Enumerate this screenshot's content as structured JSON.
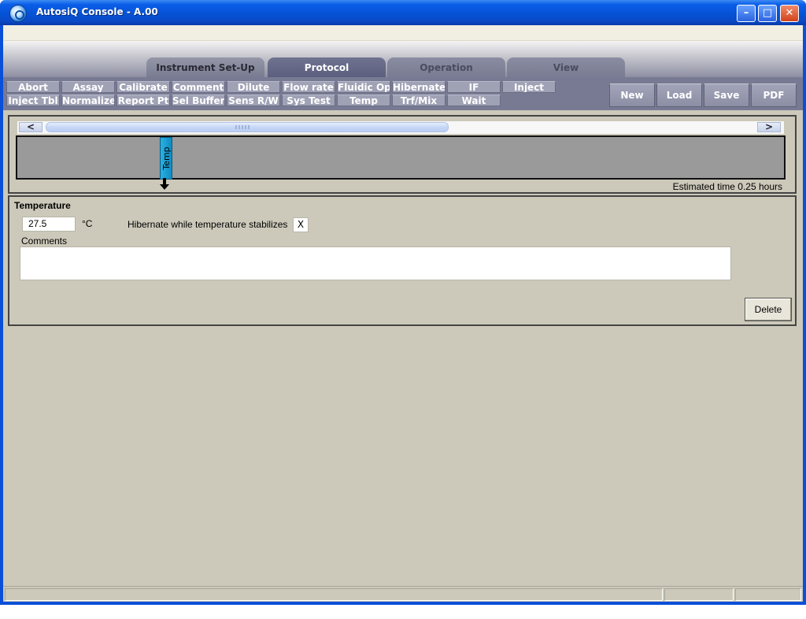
{
  "window": {
    "title": "AutosiQ Console - A.00",
    "controls": {
      "minimize": "–",
      "maximize": "□",
      "close": "✕"
    }
  },
  "tabs": [
    {
      "label": "Instrument Set-Up",
      "active": false
    },
    {
      "label": "Protocol",
      "active": true
    },
    {
      "label": "Operation",
      "active": false
    },
    {
      "label": "View",
      "active": false
    }
  ],
  "commands": {
    "row1": [
      "Abort",
      "Assay",
      "Calibrate",
      "Comment",
      "Dilute",
      "Flow rate",
      "Fluidic Op",
      "Hibernate",
      "IF",
      "Inject"
    ],
    "row2": [
      "Inject Tbl",
      "Normalize",
      "Report Pt",
      "Sel Buffer",
      "Sens R/W",
      "Sys Test",
      "Temp",
      "Trf/Mix",
      "Wait"
    ]
  },
  "actions": [
    "New",
    "Load",
    "Save",
    "PDF"
  ],
  "timeline": {
    "scroll_left": "<",
    "scroll_right": ">",
    "step_label": "Temp",
    "estimated_time": "Estimated time 0.25 hours"
  },
  "detail": {
    "title": "Temperature",
    "temperature_value": "27.5",
    "unit": "°C",
    "hibernate_label": "Hibernate while temperature stabilizes",
    "hibernate_check": "X",
    "comments_label": "Comments",
    "comments_value": "",
    "delete_label": "Delete"
  },
  "colors": {
    "titlebar": "#0552d6",
    "panel_bg": "#ccc9ba",
    "command_bar": "#787a93",
    "active_tab": "#5a5e7c",
    "timeline_step": "#1a9fd4"
  }
}
